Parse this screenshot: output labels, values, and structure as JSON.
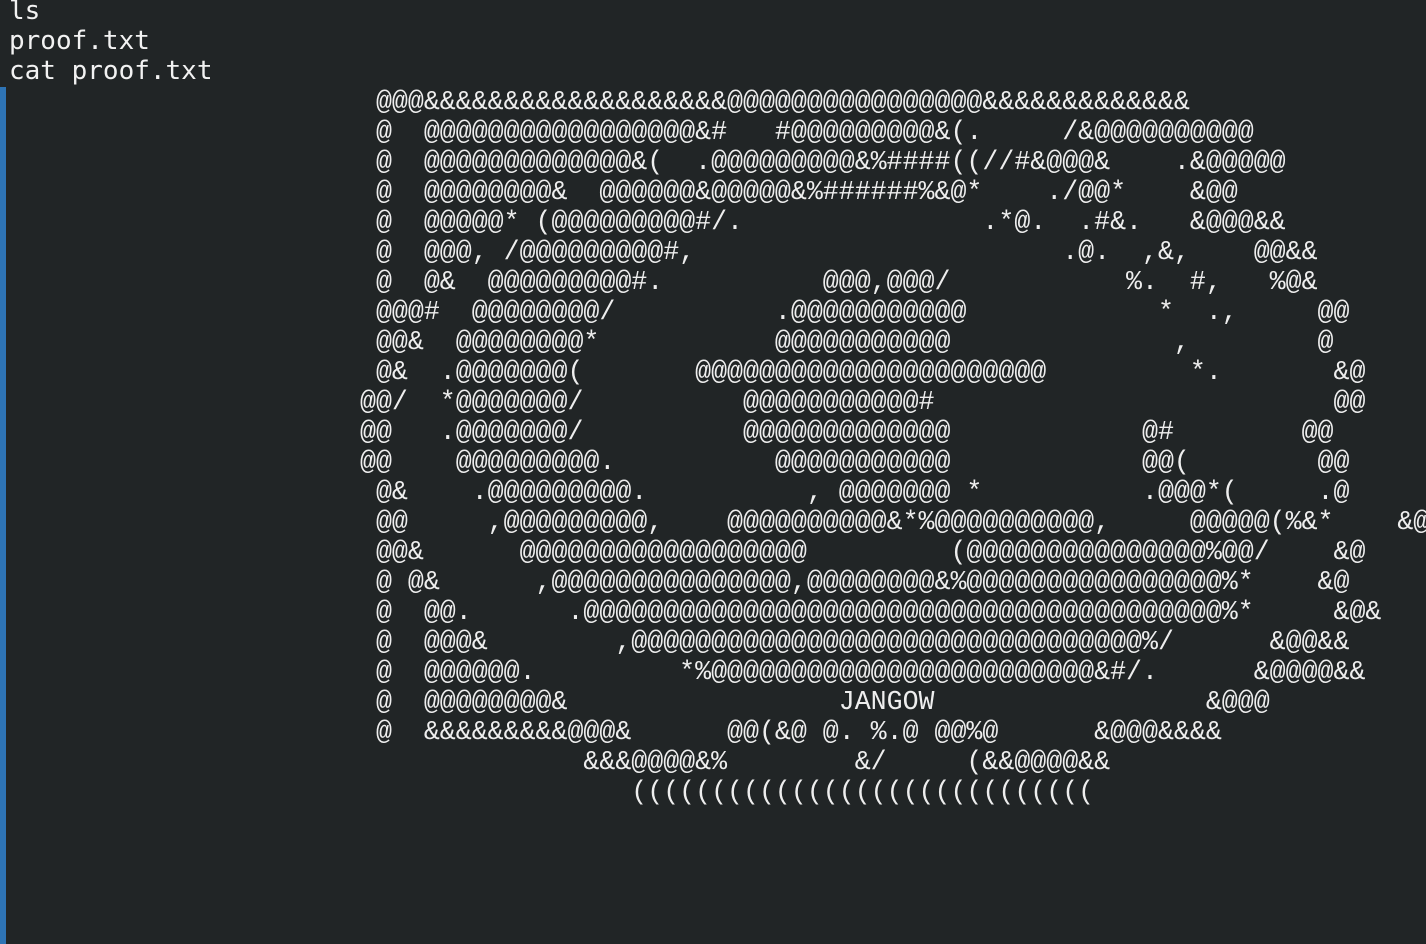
{
  "terminal": {
    "lines": [
      "ls",
      "proof.txt",
      "cat proof.txt"
    ],
    "accent_color": "#2e74b5",
    "background_color": "#212526",
    "ascii_art": " @@@&&&&&&&&&&&&&&&&&&&@@@@@@@@@@@@@@@@&&&&&&&&&&&&&\n @  @@@@@@@@@@@@@@@@@&#   #@@@@@@@@@&(.     /&@@@@@@@@@@\n @  @@@@@@@@@@@@@&(  .@@@@@@@@@&%####((//#&@@@&    .&@@@@@\n @  @@@@@@@@&  @@@@@@&@@@@@&%######%&@*    ./@@*    &@@\n @  @@@@@* (@@@@@@@@@#/.               .*@.  .#&.   &@@@&&\n @  @@@, /@@@@@@@@@#,                       .@.  ,&,    @@&&\n @  @&  @@@@@@@@@#.          @@@,@@@/           %.  #,   %@&\n @@@#  @@@@@@@@/          .@@@@@@@@@@@            *  .,     @@\n @@&  @@@@@@@@*           @@@@@@@@@@@              ,        @\n @&  .@@@@@@@(       @@@@@@@@@@@@@@@@@@@@@@         *.       &@\n@@/  *@@@@@@@/          @@@@@@@@@@@#                         @@\n@@   .@@@@@@@/          @@@@@@@@@@@@@            @#        @@\n@@    @@@@@@@@@.          @@@@@@@@@@@            @@(        @@\n @&    .@@@@@@@@@.          , @@@@@@@ *          .@@@*(     .@\n @@     ,@@@@@@@@@,    @@@@@@@@@@&*%@@@@@@@@@@,     @@@@@(%&*    &@\n @@&      @@@@@@@@@@@@@@@@@@         (@@@@@@@@@@@@@@@%@@/    &@\n @ @&      ,@@@@@@@@@@@@@@@,@@@@@@@@&%@@@@@@@@@@@@@@@@%*    &@\n @  @@.      .@@@@@@@@@@@@@@@@@@@@@@@@@@@@@@@@@@@@@@@@%*     &@&\n @  @@@&        ,@@@@@@@@@@@@@@@@@@@@@@@@@@@@@@@@%/      &@@&&\n @  @@@@@@.         *%@@@@@@@@@@@@@@@@@@@@@@@@&#/.      &@@@@&&\n @  @@@@@@@@&                 JANGOW                 &@@@\n @  &&&&&&&&&@@@&      @@(&@ @. %.@ @@%@      &@@@&&&&\n              &&&@@@@&%        &/     (&&@@@@&&\n                 ((((((((((((((((((((((((((((("
  }
}
